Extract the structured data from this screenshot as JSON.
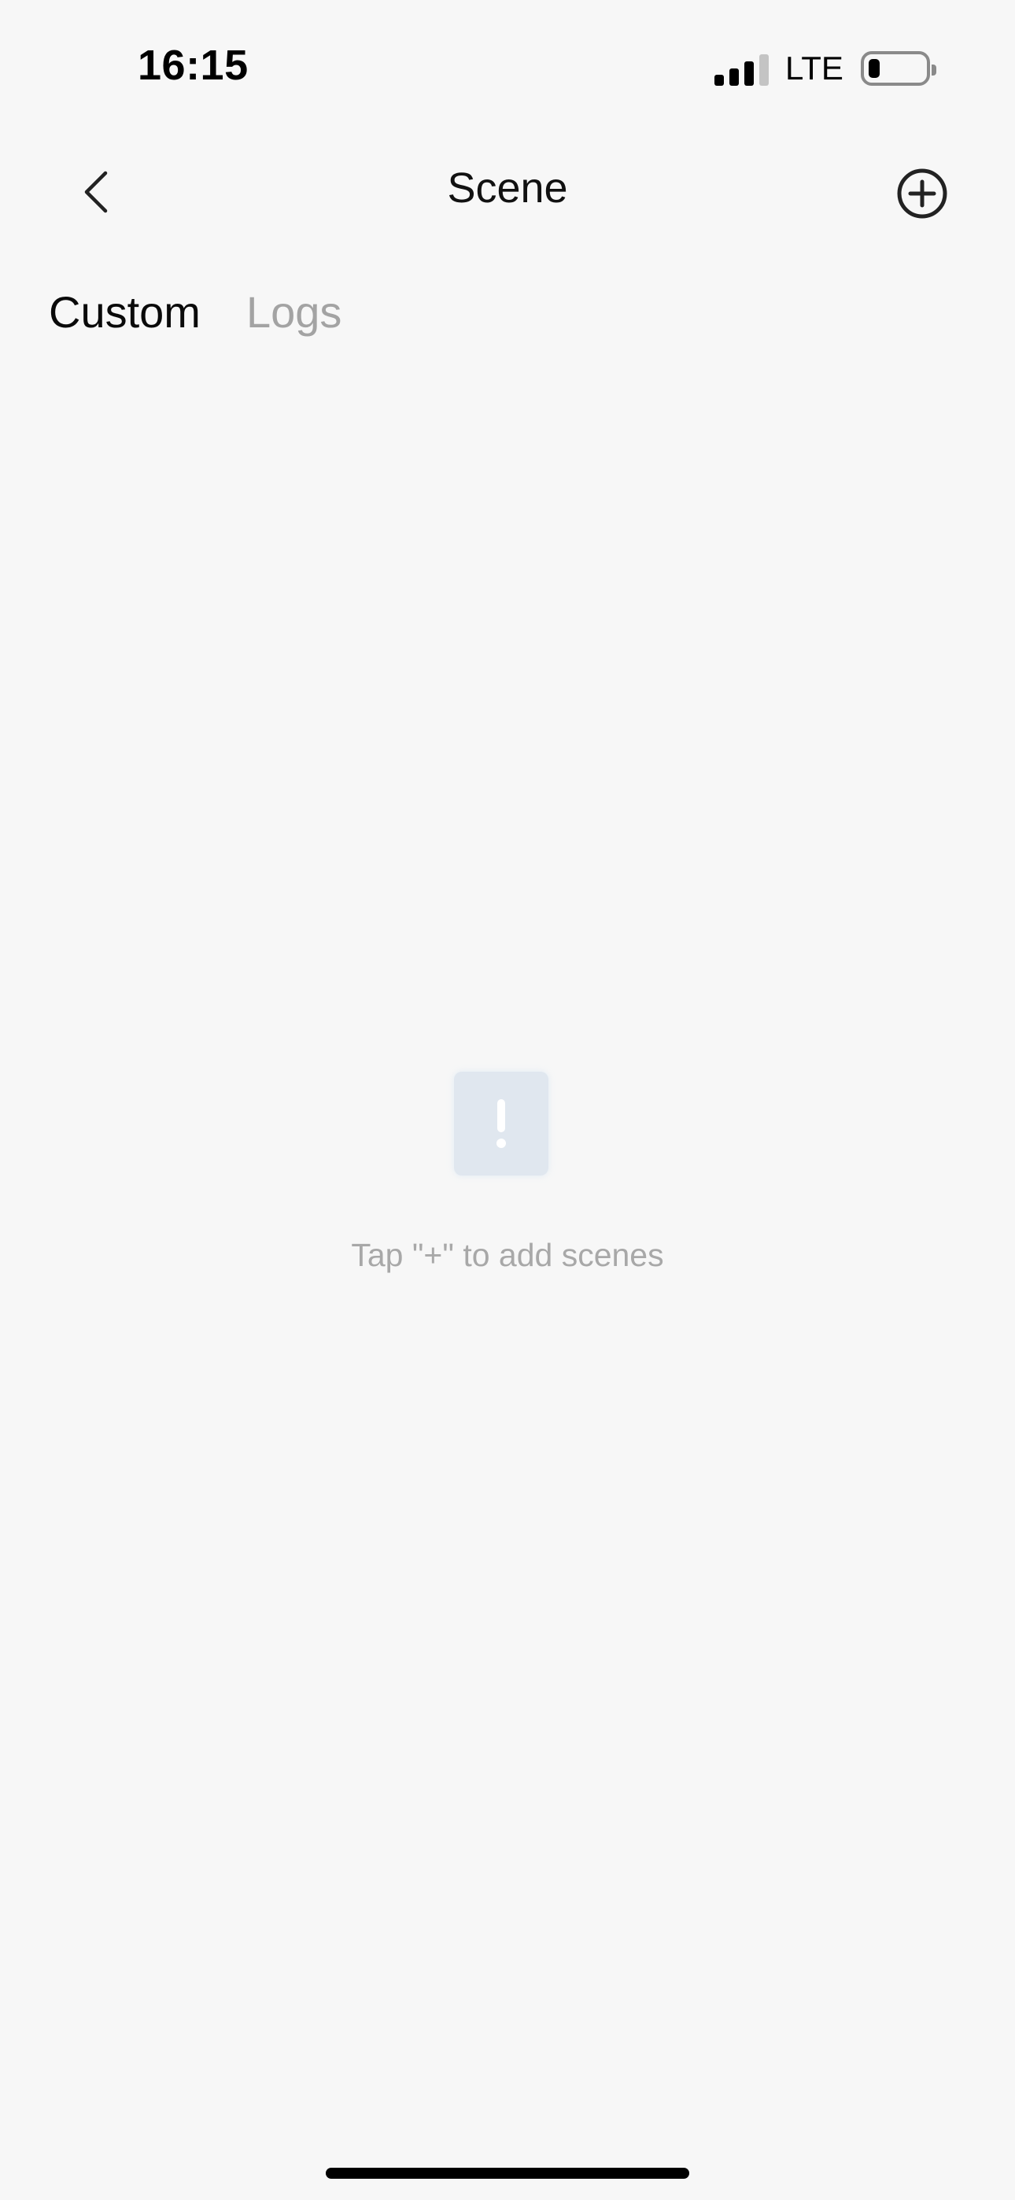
{
  "status_bar": {
    "time": "16:15",
    "network": "LTE",
    "signal_bars_active": 3,
    "signal_bars_total": 4,
    "battery_level": 0.15
  },
  "nav": {
    "title": "Scene",
    "back_icon": "chevron-left-icon",
    "add_icon": "plus-circle-icon"
  },
  "tabs": [
    {
      "label": "Custom",
      "active": true
    },
    {
      "label": "Logs",
      "active": false
    }
  ],
  "empty_state": {
    "icon": "exclamation-icon",
    "message": "Tap \"+\" to add scenes"
  },
  "colors": {
    "background": "#f7f7f7",
    "tab_active": "#0a0a0a",
    "tab_inactive": "#a3a3a3",
    "empty_icon_bg": "#e0e7ef",
    "empty_text": "#a8a8a8"
  }
}
